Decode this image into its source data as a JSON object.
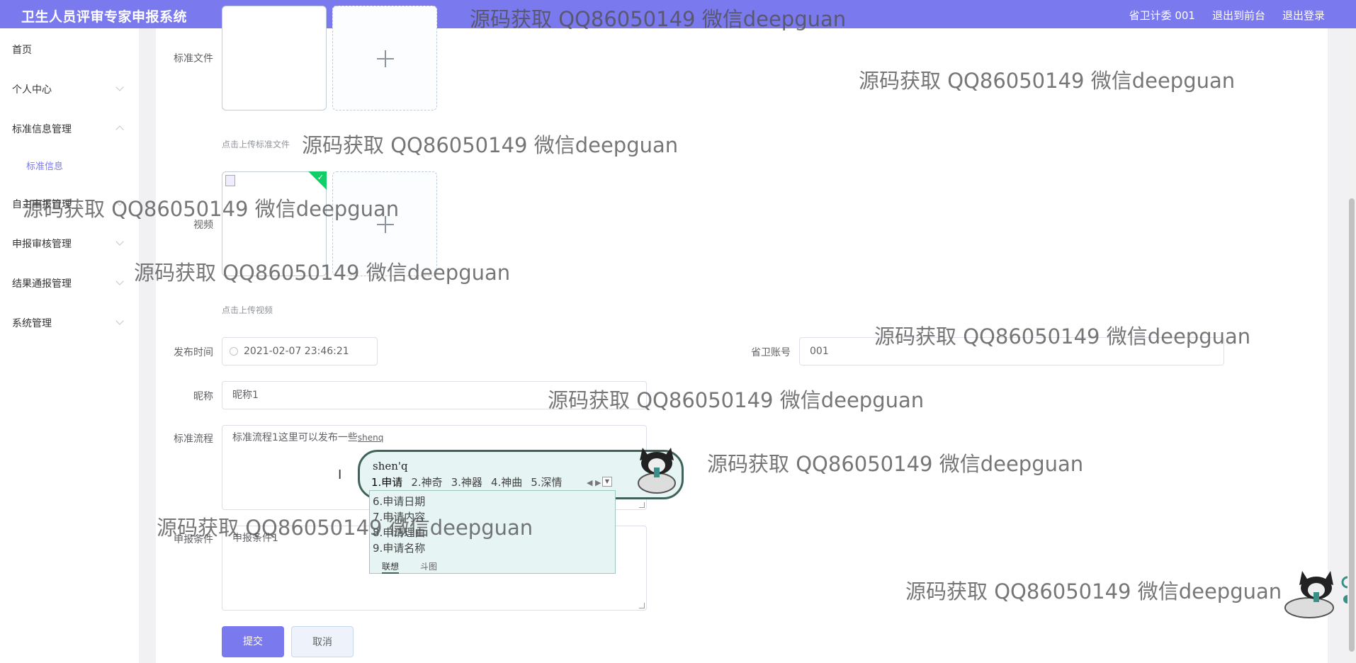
{
  "header": {
    "title": "卫生人员评审专家申报系统",
    "user_label": "省卫计委 001",
    "front_label": "退出到前台",
    "logout_label": "退出登录"
  },
  "sidebar": {
    "items": [
      {
        "label": "首页"
      },
      {
        "label": "个人中心"
      },
      {
        "label": "标准信息管理"
      },
      {
        "label": "标准信息"
      },
      {
        "label": "自主申报管理"
      },
      {
        "label": "申报审核管理"
      },
      {
        "label": "结果通报管理"
      },
      {
        "label": "系统管理"
      }
    ]
  },
  "form": {
    "standard_file_label": "标准文件",
    "standard_file_hint": "点击上传标准文件",
    "video_label": "视频",
    "video_hint": "点击上传视频",
    "publish_time_label": "发布时间",
    "publish_time_value": "2021-02-07 23:46:21",
    "account_label": "省卫账号",
    "account_value": "001",
    "nickname_label": "昵称",
    "nickname_value": "昵称1",
    "process_label": "标准流程",
    "process_value": "标准流程1这里可以发布一些",
    "process_composing": "shenq",
    "condition_label": "申报条件",
    "condition_value": "申报条件1",
    "submit_label": "提交",
    "cancel_label": "取消"
  },
  "ime": {
    "pinyin": "shen'q",
    "candidates": [
      "1.申请",
      "2.神奇",
      "3.神器",
      "4.神曲",
      "5.深情"
    ],
    "list": [
      "6.申请日期",
      "7.申请内容",
      "8.申请理由",
      "9.申请名称"
    ],
    "tabs": [
      "联想",
      "斗图"
    ]
  },
  "watermark": "源码获取 QQ86050149 微信deepguan",
  "colors": {
    "accent": "#7b79ee",
    "success": "#13ce66",
    "ime_bg": "#e6f5f3"
  }
}
